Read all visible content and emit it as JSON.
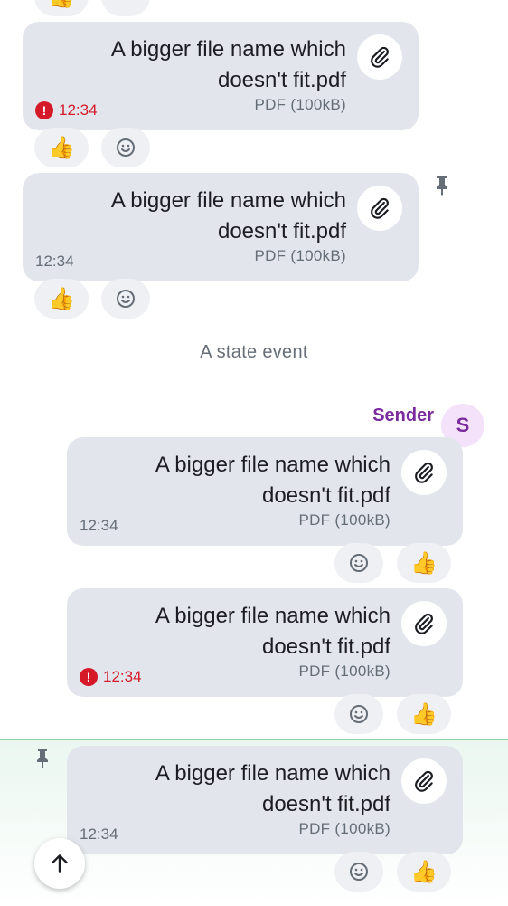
{
  "messages": [
    {
      "file_name_line1": "A bigger file name which",
      "file_name_line2": "doesn't fit.pdf",
      "file_meta": "PDF (100kB)",
      "time": "12:34",
      "error": true
    },
    {
      "file_name_line1": "A bigger file name which",
      "file_name_line2": "doesn't fit.pdf",
      "file_meta": "PDF (100kB)",
      "time": "12:34",
      "error": false
    },
    {
      "file_name_line1": "A bigger file name which",
      "file_name_line2": "doesn't fit.pdf",
      "file_meta": "PDF (100kB)",
      "time": "12:34",
      "error": false
    },
    {
      "file_name_line1": "A bigger file name which",
      "file_name_line2": "doesn't fit.pdf",
      "file_meta": "PDF (100kB)",
      "time": "12:34",
      "error": true
    },
    {
      "file_name_line1": "A bigger file name which",
      "file_name_line2": "doesn't fit.pdf",
      "file_meta": "PDF (100kB)",
      "time": "12:34",
      "error": false
    }
  ],
  "reactions": {
    "thumbs_up": "👍"
  },
  "state_event": "A state event",
  "sender": {
    "name": "Sender",
    "avatar_letter": "S"
  },
  "colors": {
    "bubble": "#e2e6ec",
    "error": "#d51928",
    "sender": "#7a2b9e",
    "highlight_border": "#8ed3a6"
  },
  "icons": [
    "paperclip-icon",
    "add-reaction-icon",
    "pin-icon",
    "error-icon",
    "arrow-up-icon"
  ]
}
